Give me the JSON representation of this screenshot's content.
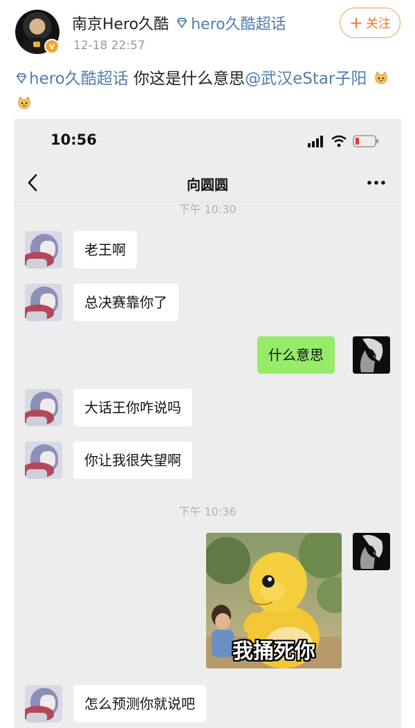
{
  "post": {
    "author_name": "南京Hero久酷",
    "topic_name": "hero久酷超话",
    "time": "12-18 22:57",
    "follow_label": "关注",
    "follow_plus": "+",
    "verified_mark": "v",
    "text_topic": "hero久酷超话",
    "text_body": " 你这是什么意思",
    "text_mention": "@武汉eStar子阳",
    "emojis": [
      "cat-emoji",
      "cat-emoji"
    ]
  },
  "chat": {
    "status_time": "10:56",
    "title": "向圆圆",
    "messages": [
      {
        "type": "timestamp",
        "text": "下午 10:30"
      },
      {
        "side": "in",
        "text": "老王啊"
      },
      {
        "side": "in",
        "text": "总决赛靠你了"
      },
      {
        "side": "out",
        "text": "什么意思"
      },
      {
        "side": "in",
        "text": "大话王你咋说吗"
      },
      {
        "side": "in",
        "text": "你让我很失望啊"
      },
      {
        "type": "timestamp",
        "text": "下午 10:36"
      },
      {
        "side": "out",
        "type": "sticker",
        "caption": "我捅死你"
      },
      {
        "side": "in",
        "text": "怎么预测你就说吧"
      }
    ]
  },
  "colors": {
    "link": "#507daf",
    "follow": "#f07b2a",
    "bubble_out": "#95ec69",
    "chat_bg": "#ededed"
  }
}
